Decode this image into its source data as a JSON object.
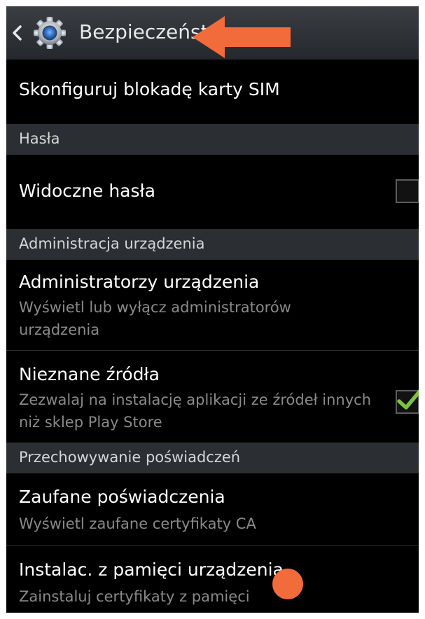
{
  "action_bar": {
    "title": "Bezpieczeństwo",
    "back_icon": "chevron-left-icon",
    "app_icon": "gear-icon"
  },
  "items": {
    "sim_lock": {
      "title": "Skonfiguruj blokadę karty SIM"
    },
    "visible_passwords": {
      "title": "Widoczne hasła",
      "checked": false
    },
    "device_admins": {
      "title": "Administratorzy urządzenia",
      "subtitle": "Wyświetl lub wyłącz administratorów urządzenia"
    },
    "unknown_sources": {
      "title": "Nieznane źródła",
      "subtitle": "Zezwalaj na instalację aplikacji ze źródeł innych niż sklep Play Store",
      "checked": true
    },
    "trusted_credentials": {
      "title": "Zaufane poświadczenia",
      "subtitle": "Wyświetl zaufane certyfikaty CA"
    },
    "install_from_storage": {
      "title": "Instalac. z pamięci urządzenia",
      "subtitle": "Zainstaluj certyfikaty z pamięci"
    }
  },
  "sections": {
    "passwords": "Hasła",
    "device_admin": "Administracja urządzenia",
    "credential_storage": "Przechowywanie poświadczeń"
  },
  "colors": {
    "background": "#000000",
    "section_header": "#2b2f33",
    "check_green": "#7dc142",
    "annotation_orange": "#f26b3a"
  }
}
